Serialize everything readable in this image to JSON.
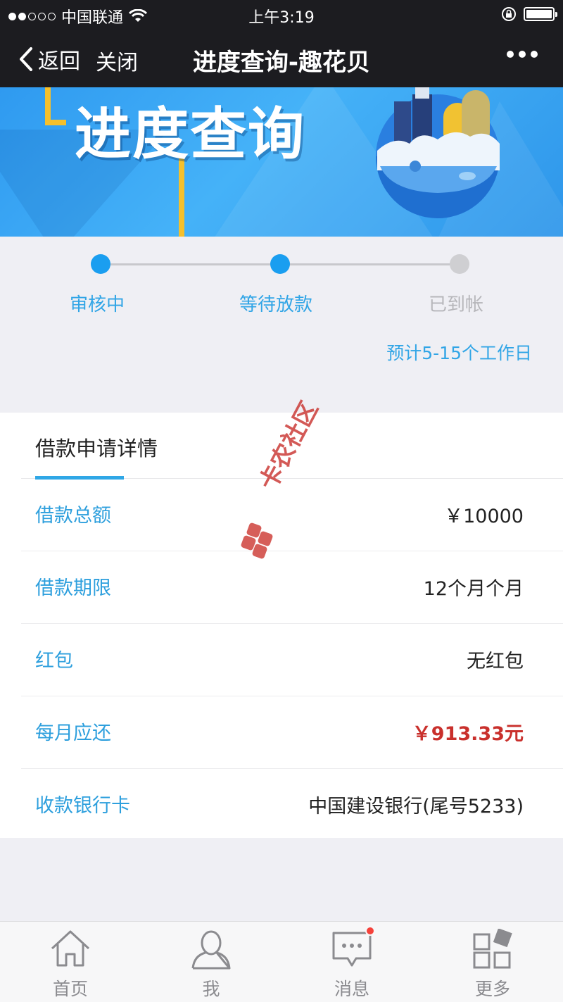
{
  "status_bar": {
    "carrier": "中国联通",
    "time": "上午3:19",
    "wifi_icon": "wifi-icon",
    "lock_icon": "orientation-lock-icon",
    "battery_icon": "battery-icon"
  },
  "nav": {
    "back_label": "返回",
    "close_label": "关闭",
    "title": "进度查询-趣花贝",
    "more_icon": "more-dots-icon"
  },
  "banner": {
    "title": "进度查询"
  },
  "progress": {
    "steps": [
      {
        "label": "审核中",
        "state": "active"
      },
      {
        "label": "等待放款",
        "state": "active"
      },
      {
        "label": "已到帐",
        "state": "inactive"
      }
    ],
    "estimate": "预计5-15个工作日"
  },
  "details": {
    "header": "借款申请详情",
    "rows": [
      {
        "label": "借款总额",
        "value": "￥10000"
      },
      {
        "label": "借款期限",
        "value": "12个月个月"
      },
      {
        "label": "红包",
        "value": "无红包"
      },
      {
        "label": "每月应还",
        "value": "￥913.33元"
      },
      {
        "label": "收款银行卡",
        "value": "中国建设银行(尾号5233)"
      }
    ]
  },
  "watermark": {
    "text": "卡农社区"
  },
  "tabs": [
    {
      "label": "首页",
      "icon": "home-icon"
    },
    {
      "label": "我",
      "icon": "user-icon"
    },
    {
      "label": "消息",
      "icon": "message-icon"
    },
    {
      "label": "更多",
      "icon": "more-grid-icon"
    }
  ],
  "colors": {
    "accent": "#2d9fdd",
    "active_dot": "#1a9ef0",
    "highlight_red": "#c9302c",
    "bar_dark": "#1c1c20"
  }
}
